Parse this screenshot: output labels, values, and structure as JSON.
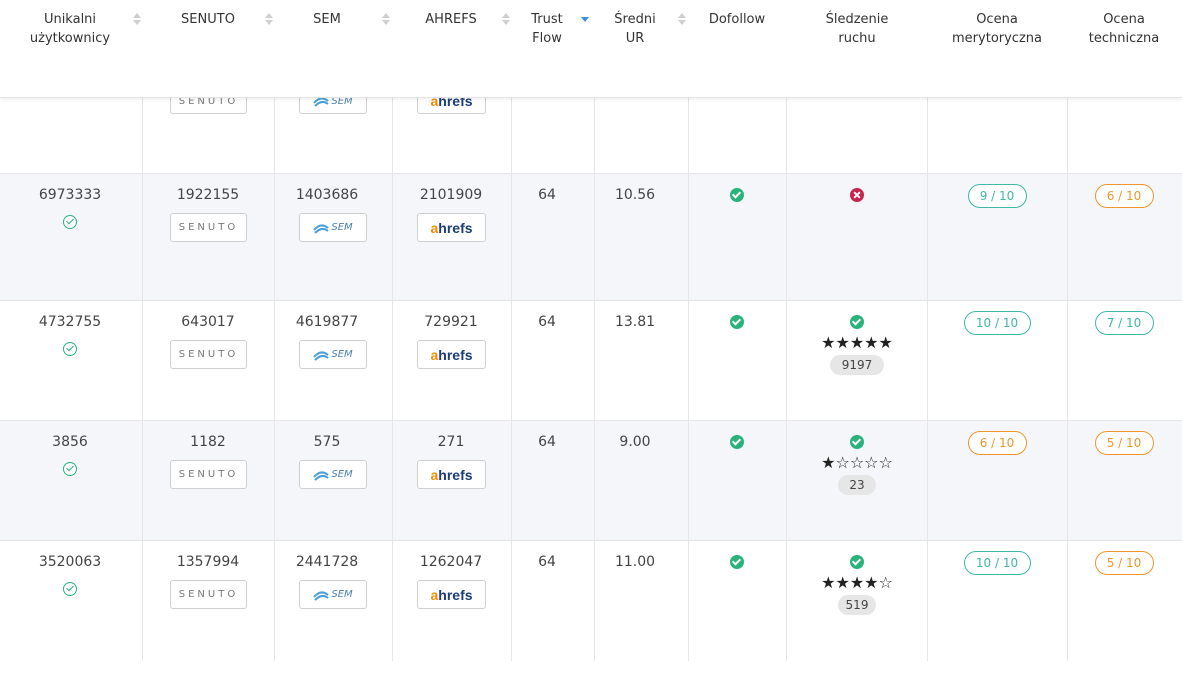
{
  "columns": [
    {
      "line1": "Unikalni",
      "line2": "użytkownicy"
    },
    {
      "line1": "SENUTO",
      "line2": ""
    },
    {
      "line1": "SEM",
      "line2": ""
    },
    {
      "line1": "AHREFS",
      "line2": ""
    },
    {
      "line1": "Trust",
      "line2": "Flow"
    },
    {
      "line1": "Średni",
      "line2": "UR"
    },
    {
      "line1": "Dofollow",
      "line2": ""
    },
    {
      "line1": "Śledzenie",
      "line2": "ruchu"
    },
    {
      "line1": "Ocena",
      "line2": "merytoryczna"
    },
    {
      "line1": "Ocena",
      "line2": "techniczna"
    }
  ],
  "logos": {
    "senuto": "SENUTO",
    "sem": "SEM",
    "ahrefs_a": "a",
    "ahrefs_rest": "hrefs"
  },
  "rows": [
    {
      "users": "6973333",
      "senuto": "1922155",
      "sem": "1403686",
      "ahrefs": "2101909",
      "tf": "64",
      "ur": "10.56",
      "tracking": false,
      "stars": "",
      "count": "",
      "merit": "9 / 10",
      "merit_color": "green",
      "tech": "6 / 10",
      "tech_color": "orange"
    },
    {
      "users": "4732755",
      "senuto": "643017",
      "sem": "4619877",
      "ahrefs": "729921",
      "tf": "64",
      "ur": "13.81",
      "tracking": true,
      "stars": "★★★★★",
      "count": "9197",
      "merit": "10 / 10",
      "merit_color": "green",
      "tech": "7 / 10",
      "tech_color": "green"
    },
    {
      "users": "3856",
      "senuto": "1182",
      "sem": "575",
      "ahrefs": "271",
      "tf": "64",
      "ur": "9.00",
      "tracking": true,
      "stars": "★☆☆☆☆",
      "count": "23",
      "merit": "6 / 10",
      "merit_color": "orange",
      "tech": "5 / 10",
      "tech_color": "orange"
    },
    {
      "users": "3520063",
      "senuto": "1357994",
      "sem": "2441728",
      "ahrefs": "1262047",
      "tf": "64",
      "ur": "11.00",
      "tracking": true,
      "stars": "★★★★☆",
      "count": "519",
      "merit": "10 / 10",
      "merit_color": "green",
      "tech": "5 / 10",
      "tech_color": "orange"
    }
  ],
  "colors": {
    "green": "#3fb8a6",
    "orange": "#f0952b",
    "check": "#2ab27b",
    "cross": "#c7254e",
    "sort_active": "#3a8fd9"
  }
}
